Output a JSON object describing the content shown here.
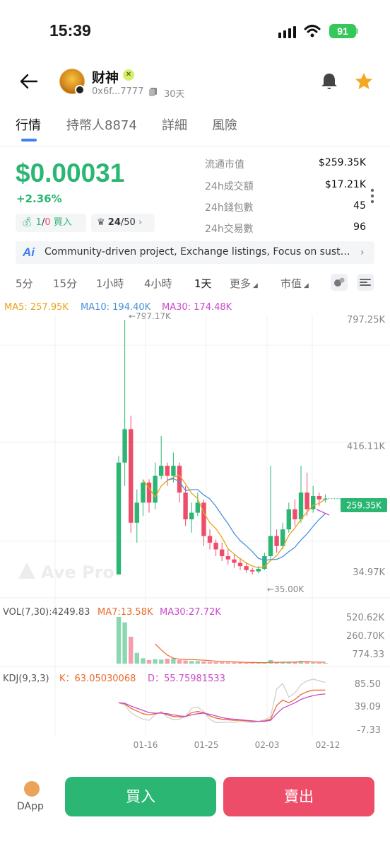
{
  "status_bar": {
    "time": "15:39",
    "battery": "91"
  },
  "header": {
    "token_name": "财神",
    "address": "0x6f...7777",
    "age": "30天"
  },
  "tabs": [
    {
      "label": "行情",
      "active": true
    },
    {
      "label": "持幣人8874",
      "active": false
    },
    {
      "label": "詳細",
      "active": false
    },
    {
      "label": "風險",
      "active": false
    }
  ],
  "price": {
    "value": "$0.00031",
    "change": "+2.36%",
    "chip_buy": {
      "count_green": "1",
      "slash": "/",
      "count_red": "0",
      "label": "買入"
    },
    "chip_rank": {
      "value": "24",
      "total": "/50"
    }
  },
  "stats": [
    {
      "label": "流通市值",
      "value": "$259.35K"
    },
    {
      "label": "24h成交額",
      "value": "$17.21K"
    },
    {
      "label": "24h錢包數",
      "value": "45"
    },
    {
      "label": "24h交易數",
      "value": "96"
    }
  ],
  "ai_banner": {
    "icon_text": "Ai",
    "text": "Community-driven project, Exchange listings, Focus on sustainable growth"
  },
  "timeframes": [
    {
      "label": "5分",
      "active": false
    },
    {
      "label": "15分",
      "active": false
    },
    {
      "label": "1小時",
      "active": false
    },
    {
      "label": "4小時",
      "active": false
    },
    {
      "label": "1天",
      "active": true
    },
    {
      "label": "更多",
      "active": false
    },
    {
      "label": "市值",
      "active": false
    }
  ],
  "colors": {
    "up": "#2bb673",
    "down": "#ee4d6a",
    "ma5": "#e8a317",
    "ma10": "#4a90d9",
    "ma30": "#c94ac9",
    "accent": "#3d7ff5"
  },
  "chart_data": {
    "type": "candlestick",
    "watermark": "Ave Pro",
    "price_axis": [
      "797.25K",
      "416.11K",
      "34.97K"
    ],
    "current_label": "259.35K",
    "high_marker": "←797.17K",
    "low_marker": "←35.00K",
    "x_labels": [
      "01-16",
      "01-25",
      "02-03",
      "02-12"
    ],
    "legend": [
      {
        "text": "MA5: 257.95K",
        "color": "#e8a317"
      },
      {
        "text": "MA10: 194.40K",
        "color": "#4a90d9"
      },
      {
        "text": "MA30: 174.48K",
        "color": "#c94ac9"
      }
    ],
    "ylim": [
      34970,
      797250
    ],
    "candles": [
      {
        "o": 35000,
        "c": 370000,
        "h": 390000,
        "l": 35000
      },
      {
        "o": 370000,
        "c": 470000,
        "h": 797170,
        "l": 300000
      },
      {
        "o": 470000,
        "c": 190000,
        "h": 510000,
        "l": 160000
      },
      {
        "o": 190000,
        "c": 250000,
        "h": 290000,
        "l": 130000
      },
      {
        "o": 250000,
        "c": 310000,
        "h": 320000,
        "l": 210000
      },
      {
        "o": 310000,
        "c": 250000,
        "h": 320000,
        "l": 220000
      },
      {
        "o": 250000,
        "c": 330000,
        "h": 370000,
        "l": 230000
      },
      {
        "o": 330000,
        "c": 360000,
        "h": 450000,
        "l": 320000
      },
      {
        "o": 360000,
        "c": 330000,
        "h": 370000,
        "l": 300000
      },
      {
        "o": 330000,
        "c": 360000,
        "h": 400000,
        "l": 310000
      },
      {
        "o": 360000,
        "c": 280000,
        "h": 370000,
        "l": 250000
      },
      {
        "o": 280000,
        "c": 200000,
        "h": 300000,
        "l": 180000
      },
      {
        "o": 200000,
        "c": 220000,
        "h": 250000,
        "l": 160000
      },
      {
        "o": 220000,
        "c": 250000,
        "h": 280000,
        "l": 210000
      },
      {
        "o": 250000,
        "c": 150000,
        "h": 260000,
        "l": 120000
      },
      {
        "o": 150000,
        "c": 130000,
        "h": 170000,
        "l": 110000
      },
      {
        "o": 130000,
        "c": 110000,
        "h": 140000,
        "l": 90000
      },
      {
        "o": 110000,
        "c": 90000,
        "h": 130000,
        "l": 75000
      },
      {
        "o": 90000,
        "c": 80000,
        "h": 110000,
        "l": 65000
      },
      {
        "o": 80000,
        "c": 70000,
        "h": 95000,
        "l": 55000
      },
      {
        "o": 70000,
        "c": 60000,
        "h": 85000,
        "l": 48000
      },
      {
        "o": 60000,
        "c": 48000,
        "h": 70000,
        "l": 40000
      },
      {
        "o": 48000,
        "c": 44000,
        "h": 55000,
        "l": 35000
      },
      {
        "o": 44000,
        "c": 52000,
        "h": 60000,
        "l": 38000
      },
      {
        "o": 52000,
        "c": 90000,
        "h": 100000,
        "l": 48000
      },
      {
        "o": 90000,
        "c": 150000,
        "h": 360000,
        "l": 80000
      },
      {
        "o": 150000,
        "c": 120000,
        "h": 170000,
        "l": 100000
      },
      {
        "o": 120000,
        "c": 170000,
        "h": 190000,
        "l": 110000
      },
      {
        "o": 170000,
        "c": 230000,
        "h": 250000,
        "l": 160000
      },
      {
        "o": 230000,
        "c": 200000,
        "h": 260000,
        "l": 180000
      },
      {
        "o": 200000,
        "c": 280000,
        "h": 360000,
        "l": 190000
      },
      {
        "o": 280000,
        "c": 230000,
        "h": 340000,
        "l": 210000
      },
      {
        "o": 230000,
        "c": 270000,
        "h": 300000,
        "l": 220000
      },
      {
        "o": 270000,
        "c": 259350,
        "h": 280000,
        "l": 240000
      },
      {
        "o": 259350,
        "c": 262000,
        "h": 275000,
        "l": 250000
      }
    ],
    "volume": {
      "label": "VOL(7,30):4249.83",
      "ma7": "MA7:13.58K",
      "ma30": "MA30:27.72K",
      "axis": [
        "520.62K",
        "260.70K",
        "774.33"
      ],
      "ylim": [
        0,
        520620
      ],
      "values": [
        520620,
        460000,
        300000,
        120000,
        60000,
        40000,
        50000,
        45000,
        55000,
        60000,
        40000,
        35000,
        30000,
        28000,
        25000,
        20000,
        18000,
        16000,
        14000,
        12000,
        11000,
        10000,
        9000,
        9500,
        12000,
        40000,
        15000,
        14000,
        16000,
        18000,
        30000,
        22000,
        10000,
        9000,
        4249
      ]
    },
    "kdj": {
      "label": "KDJ(9,3,3)",
      "k": "K：63.05030068",
      "d": "D：55.75981533",
      "axis": [
        "85.50",
        "39.09",
        "-7.33"
      ],
      "ylim": [
        -7.33,
        85.5
      ],
      "k_values": [
        40,
        38,
        30,
        25,
        20,
        18,
        20,
        22,
        18,
        15,
        14,
        15,
        22,
        24,
        22,
        16,
        12,
        10,
        9,
        8,
        8,
        7,
        6,
        6,
        7,
        10,
        35,
        45,
        40,
        46,
        55,
        60,
        63,
        63,
        63
      ],
      "d_values": [
        40,
        39,
        34,
        30,
        26,
        22,
        21,
        21,
        20,
        18,
        16,
        15,
        18,
        20,
        21,
        19,
        16,
        13,
        11,
        10,
        9,
        8,
        7,
        6,
        6,
        8,
        20,
        30,
        35,
        40,
        46,
        50,
        53,
        55,
        56
      ],
      "j_values": [
        40,
        36,
        22,
        15,
        10,
        8,
        18,
        24,
        14,
        9,
        10,
        15,
        30,
        32,
        24,
        10,
        4,
        4,
        5,
        4,
        6,
        5,
        4,
        6,
        9,
        14,
        65,
        75,
        50,
        58,
        73,
        80,
        83,
        80,
        77
      ]
    }
  },
  "bottom": {
    "dapp_label": "DApp",
    "buy_label": "買入",
    "sell_label": "賣出"
  }
}
